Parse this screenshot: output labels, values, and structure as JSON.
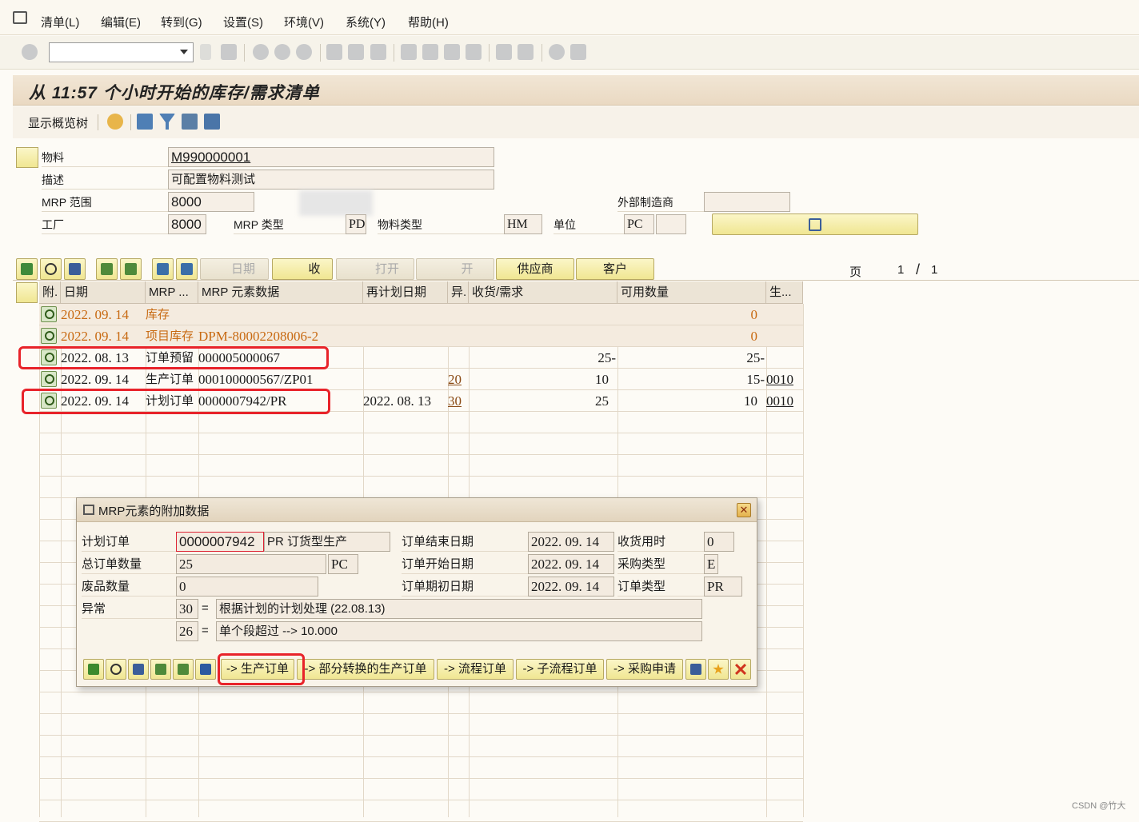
{
  "menu": {
    "items": [
      "清单(L)",
      "编辑(E)",
      "转到(G)",
      "设置(S)",
      "环境(V)",
      "系统(Y)",
      "帮助(H)"
    ]
  },
  "title": "从 11:57 个小时开始的库存/需求清单",
  "app_toolbar": {
    "overview_tree": "显示概览树"
  },
  "header": {
    "material_label": "物料",
    "material": "M990000001",
    "desc_label": "描述",
    "desc": "可配置物料测试",
    "mrp_area_label": "MRP 范围",
    "mrp_area": "8000",
    "plant_label": "工厂",
    "plant": "8000",
    "mrp_type_label": "MRP 类型",
    "mrp_type": "PD",
    "mat_type_label": "物料类型",
    "mat_type": "HM",
    "unit_label": "单位",
    "unit": "PC",
    "ext_mfr_label": "外部制造商",
    "ext_mfr": ""
  },
  "grid_toolbar": {
    "date": "日期",
    "receipt": "收",
    "open": "打开",
    "open2": "开",
    "vendor": "供应商",
    "customer": "客户",
    "page_label": "页",
    "page": "1",
    "page_sep": "/",
    "pages": "1"
  },
  "table": {
    "headers": [
      "附.",
      "日期",
      "MRP ...",
      "MRP 元素数据",
      "再计划日期",
      "异.",
      "收货/需求",
      "可用数量",
      "生..."
    ],
    "rows": [
      {
        "date": "2022. 09. 14",
        "mrp": "库存",
        "data": "",
        "resched": "",
        "exc": "",
        "qty": "",
        "avail": "0",
        "prod": ""
      },
      {
        "date": "2022. 09. 14",
        "mrp": "项目库存",
        "data": "DPM-80002208006-2",
        "resched": "",
        "exc": "",
        "qty": "",
        "avail": "0",
        "prod": ""
      },
      {
        "date": "2022. 08. 13",
        "mrp": "订单预留",
        "data": "000005000067",
        "resched": "",
        "exc": "",
        "qty": "25-",
        "avail": "25-",
        "prod": ""
      },
      {
        "date": "2022. 09. 14",
        "mrp": "生产订单",
        "data": "000100000567/ZP01",
        "resched": "",
        "exc": "20",
        "qty": "10",
        "avail": "15-",
        "prod": "0010"
      },
      {
        "date": "2022. 09. 14",
        "mrp": "计划订单",
        "data": "0000007942/PR",
        "resched": "2022. 08. 13",
        "exc": "30",
        "qty": "25",
        "avail": "10",
        "prod": "0010"
      }
    ]
  },
  "popup": {
    "title": "MRP元素的附加数据",
    "planned_order_label": "计划订单",
    "planned_order": "0000007942",
    "order_type_desc": "PR 订货型生产",
    "total_qty_label": "总订单数量",
    "total_qty": "25",
    "total_unit": "PC",
    "scrap_label": "废品数量",
    "scrap": "0",
    "exception_label": "异常",
    "exc1_code": "30",
    "exc1_eq": "=",
    "exc1_text": "根据计划的计划处理 (22.08.13)",
    "exc2_code": "26",
    "exc2_eq": "=",
    "exc2_text": "单个段超过 --> 10.000",
    "end_date_label": "订单结束日期",
    "end_date": "2022. 09. 14",
    "start_date_label": "订单开始日期",
    "start_date": "2022. 09. 14",
    "open_date_label": "订单期初日期",
    "open_date": "2022. 09. 14",
    "gr_time_label": "收货用时",
    "gr_time": "0",
    "proc_type_label": "采购类型",
    "proc_type": "E",
    "ord_type_label": "订单类型",
    "ord_type": "PR",
    "btn_prod_order": "-> 生产订单",
    "btn_partial": "-> 部分转换的生产订单",
    "btn_process": "-> 流程订单",
    "btn_subprocess": "-> 子流程订单",
    "btn_purreq": "-> 采购申请"
  },
  "watermark": "CSDN @竹大"
}
